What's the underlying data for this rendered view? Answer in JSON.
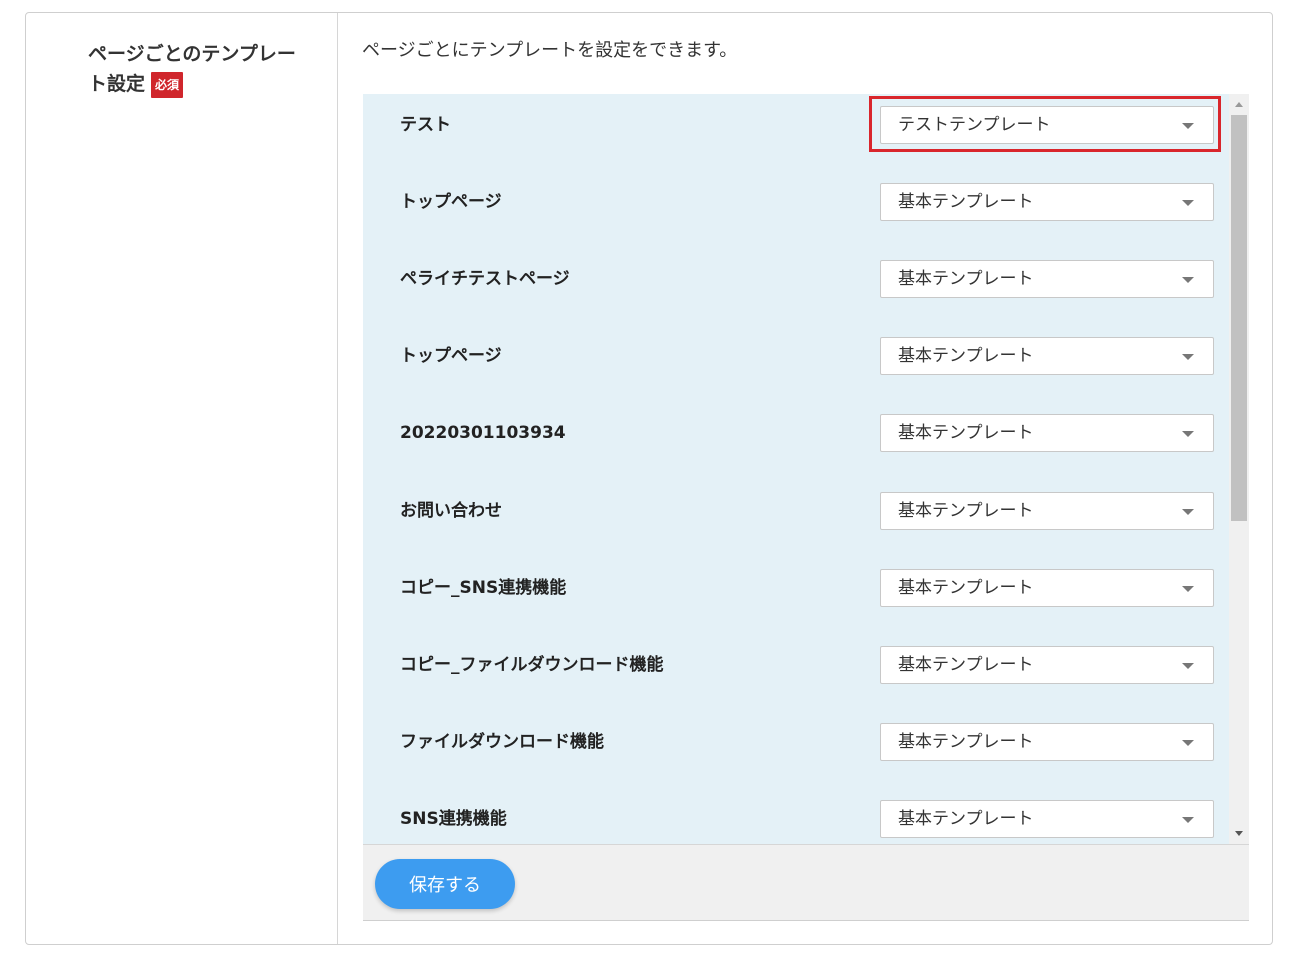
{
  "setting": {
    "title": "ページごとのテンプレート設定",
    "required_badge": "必須",
    "description": "ページごとにテンプレートを設定をできます。"
  },
  "rows": [
    {
      "label": "テスト",
      "template": "テストテンプレート",
      "highlighted": true
    },
    {
      "label": "トップページ",
      "template": "基本テンプレート"
    },
    {
      "label": "ペライチテストページ",
      "template": "基本テンプレート"
    },
    {
      "label": "トップページ",
      "template": "基本テンプレート"
    },
    {
      "label": "20220301103934",
      "template": "基本テンプレート"
    },
    {
      "label": "お問い合わせ",
      "template": "基本テンプレート"
    },
    {
      "label": "コピー_SNS連携機能",
      "template": "基本テンプレート"
    },
    {
      "label": "コピー_ファイルダウンロード機能",
      "template": "基本テンプレート"
    },
    {
      "label": "ファイルダウンロード機能",
      "template": "基本テンプレート"
    },
    {
      "label": "SNS連携機能",
      "template": "基本テンプレート"
    }
  ],
  "footer": {
    "save_label": "保存する"
  },
  "colors": {
    "highlight": "#d9262c",
    "save_button": "#3d9cf0",
    "list_bg": "#e4f1f7",
    "badge": "#d0262c"
  }
}
